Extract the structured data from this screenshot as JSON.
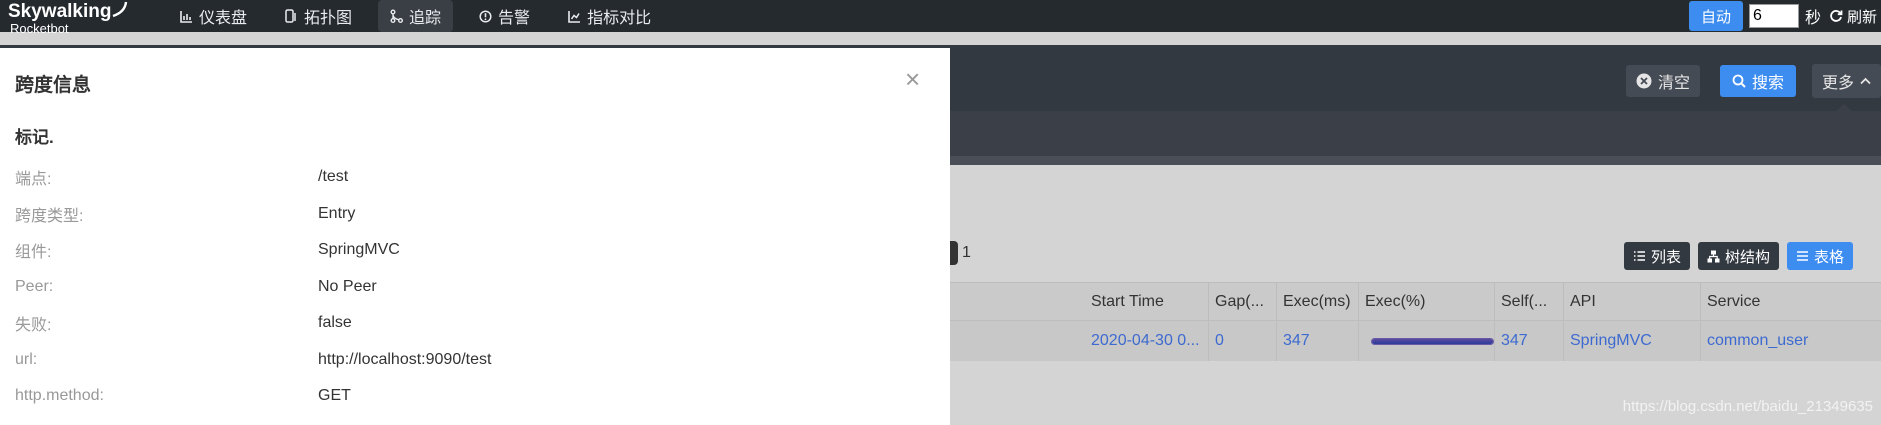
{
  "app": {
    "logo_main": "Skywalking",
    "logo_sub": "Rocketbot"
  },
  "nav": {
    "items": [
      {
        "label": "仪表盘",
        "icon": "dashboard-chart-icon"
      },
      {
        "label": "拓扑图",
        "icon": "topology-icon"
      },
      {
        "label": "追踪",
        "icon": "trace-branch-icon",
        "active": true
      },
      {
        "label": "告警",
        "icon": "alarm-icon"
      },
      {
        "label": "指标对比",
        "icon": "metric-compare-icon"
      }
    ],
    "auto_label": "自动",
    "interval_value": "6",
    "interval_unit": "秒",
    "refresh_label": "刷新"
  },
  "toolbar": {
    "clear_label": "清空",
    "search_label": "搜索",
    "more_label": "更多"
  },
  "trace": {
    "page_number": "1",
    "views": [
      {
        "label": "列表",
        "icon": "list-icon"
      },
      {
        "label": "树结构",
        "icon": "tree-icon"
      },
      {
        "label": "表格",
        "icon": "table-icon",
        "active": true
      }
    ],
    "columns": [
      "Start Time",
      "Gap(...",
      "Exec(ms)",
      "Exec(%)",
      "Self(...",
      "API",
      "Service"
    ],
    "rows": [
      {
        "start_time": "2020-04-30 0...",
        "gap": "0",
        "exec_ms": "347",
        "exec_pct": 100,
        "self": "347",
        "api": "SpringMVC",
        "service": "common_user"
      }
    ]
  },
  "panel": {
    "title": "跨度信息",
    "close": "×",
    "section": "标记.",
    "fields": [
      {
        "key": "端点:",
        "value": "/test"
      },
      {
        "key": "跨度类型:",
        "value": "Entry"
      },
      {
        "key": "组件:",
        "value": "SpringMVC"
      },
      {
        "key": "Peer:",
        "value": "No Peer"
      },
      {
        "key": "失败:",
        "value": "false"
      },
      {
        "key": "url:",
        "value": "http://localhost:9090/test"
      },
      {
        "key": "http.method:",
        "value": "GET"
      }
    ]
  },
  "watermark": "https://blog.csdn.net/baidu_21349635",
  "colors": {
    "nav_bg": "#252a2f",
    "accent": "#3d8cf0",
    "link": "#3d6ad0"
  }
}
